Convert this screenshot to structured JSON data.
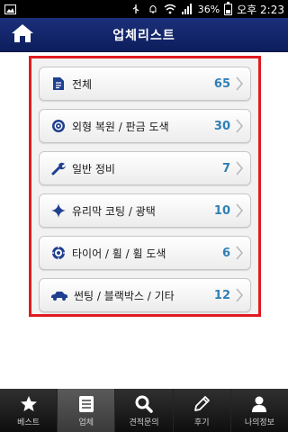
{
  "status_bar": {
    "battery": "36%",
    "time": "오후 2:23"
  },
  "header": {
    "title": "업체리스트"
  },
  "categories": [
    {
      "label": "전체",
      "count": "65",
      "icon": "document-icon"
    },
    {
      "label": "외형 복원 / 판금 도색",
      "count": "30",
      "icon": "target-icon"
    },
    {
      "label": "일반 정비",
      "count": "7",
      "icon": "wrench-icon"
    },
    {
      "label": "유리막 코팅 / 광택",
      "count": "10",
      "icon": "sparkle-icon"
    },
    {
      "label": "타이어 / 휠 / 휠 도색",
      "count": "6",
      "icon": "tire-icon"
    },
    {
      "label": "썬팅 / 블랙박스 / 기타",
      "count": "12",
      "icon": "car-icon"
    }
  ],
  "bottom_nav": [
    {
      "label": "베스트",
      "icon": "star-icon"
    },
    {
      "label": "업체",
      "icon": "list-icon"
    },
    {
      "label": "견적문의",
      "icon": "search-icon"
    },
    {
      "label": "후기",
      "icon": "pencil-icon"
    },
    {
      "label": "나의정보",
      "icon": "person-icon"
    }
  ],
  "active_nav_index": 1,
  "colors": {
    "header_bg": "#14276d",
    "frame_border": "#e01b20",
    "count_text": "#2f7fb6",
    "icon_blue": "#1f3f8f"
  }
}
